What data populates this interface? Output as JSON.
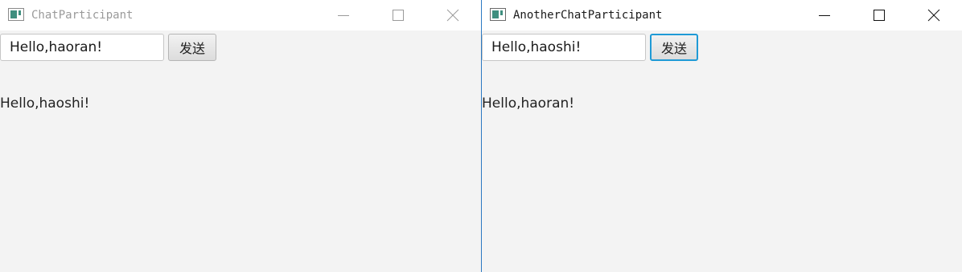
{
  "windows": [
    {
      "title": "ChatParticipant",
      "input_value": "Hello,haoran!",
      "send_label": "发送",
      "received_message": "Hello,haoshi!",
      "active": false
    },
    {
      "title": "AnotherChatParticipant",
      "input_value": "Hello,haoshi!",
      "send_label": "发送",
      "received_message": "Hello,haoran!",
      "active": true
    }
  ],
  "icons": {
    "app": "java-window-icon",
    "minimize": "minimize-icon",
    "maximize": "maximize-icon",
    "close": "close-icon"
  },
  "colors": {
    "window_background": "#f3f3f3",
    "titlebar_background": "#ffffff",
    "inactive_title": "#9a9a9a",
    "active_title": "#1a1a1a",
    "focus_border": "#1f9ad6"
  }
}
